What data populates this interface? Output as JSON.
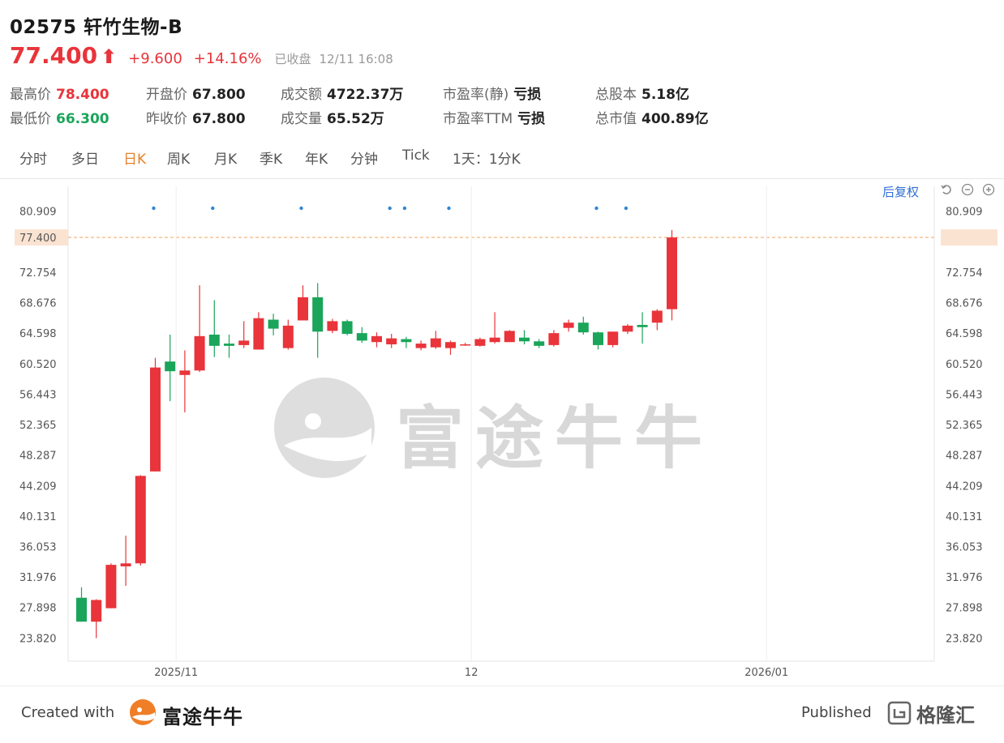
{
  "header": {
    "title": "02575 轩竹生物-B",
    "price": "77.400",
    "arrow": "⬆",
    "change": "+9.600",
    "change_pct": "+14.16%",
    "status": "已收盘",
    "status_time": "12/11 16:08"
  },
  "stats": {
    "high_label": "最高价",
    "high": "78.400",
    "low_label": "最低价",
    "low": "66.300",
    "open_label": "开盘价",
    "open": "67.800",
    "prev_label": "昨收价",
    "prev": "67.800",
    "turnover_label": "成交额",
    "turnover": "4722.37万",
    "volume_label": "成交量",
    "volume": "65.52万",
    "pe_static_label": "市盈率(静)",
    "pe_static": "亏损",
    "pe_ttm_label": "市盈率TTM",
    "pe_ttm": "亏损",
    "shares_label": "总股本",
    "shares": "5.18亿",
    "mktcap_label": "总市值",
    "mktcap": "400.89亿"
  },
  "tabs": [
    "分时",
    "多日",
    "日K",
    "周K",
    "月K",
    "季K",
    "年K",
    "分钟",
    "Tick",
    "1天：1分K"
  ],
  "active_tab": "日K",
  "controls": {
    "adjust": "后复权"
  },
  "colors": {
    "up": "#e8343a",
    "down": "#1aa55a",
    "accent": "#e8812a",
    "link": "#2f6fd4",
    "last_line": "#f2a35e"
  },
  "chart_data": {
    "type": "candlestick",
    "y_ticks": [
      "80.909",
      "77.400",
      "72.754",
      "68.676",
      "64.598",
      "60.520",
      "56.443",
      "52.365",
      "48.287",
      "44.209",
      "40.131",
      "36.053",
      "31.976",
      "27.898",
      "23.820"
    ],
    "ylim": [
      21.8,
      82.5
    ],
    "last_price": 77.4,
    "x_ticks": [
      {
        "label": "2025/11",
        "index": 6
      },
      {
        "label": "12",
        "index": 26
      },
      {
        "label": "2026/01",
        "index": 46
      }
    ],
    "event_dot_indices": [
      5,
      9,
      15,
      21,
      22,
      25,
      35,
      37
    ],
    "candles": [
      {
        "o": 29.2,
        "h": 30.6,
        "l": 26.0,
        "c": 26.0
      },
      {
        "o": 26.0,
        "h": 29.0,
        "l": 23.8,
        "c": 28.9
      },
      {
        "o": 27.8,
        "h": 33.8,
        "l": 27.8,
        "c": 33.6
      },
      {
        "o": 33.4,
        "h": 37.5,
        "l": 30.8,
        "c": 33.8
      },
      {
        "o": 33.8,
        "h": 45.6,
        "l": 33.5,
        "c": 45.5
      },
      {
        "o": 46.1,
        "h": 61.3,
        "l": 46.1,
        "c": 60.0
      },
      {
        "o": 60.8,
        "h": 64.4,
        "l": 55.5,
        "c": 59.5
      },
      {
        "o": 59.0,
        "h": 62.3,
        "l": 54.0,
        "c": 59.6
      },
      {
        "o": 59.6,
        "h": 71.0,
        "l": 59.4,
        "c": 64.2
      },
      {
        "o": 64.4,
        "h": 69.0,
        "l": 61.4,
        "c": 62.9
      },
      {
        "o": 63.2,
        "h": 64.4,
        "l": 61.3,
        "c": 62.9
      },
      {
        "o": 63.0,
        "h": 66.2,
        "l": 62.6,
        "c": 63.6
      },
      {
        "o": 62.4,
        "h": 67.4,
        "l": 62.4,
        "c": 66.6
      },
      {
        "o": 66.4,
        "h": 67.2,
        "l": 64.3,
        "c": 65.2
      },
      {
        "o": 62.6,
        "h": 66.4,
        "l": 62.4,
        "c": 65.6
      },
      {
        "o": 66.3,
        "h": 71.0,
        "l": 66.3,
        "c": 69.4
      },
      {
        "o": 69.4,
        "h": 71.3,
        "l": 61.3,
        "c": 64.8
      },
      {
        "o": 64.9,
        "h": 66.5,
        "l": 64.6,
        "c": 66.2
      },
      {
        "o": 66.2,
        "h": 66.4,
        "l": 64.3,
        "c": 64.5
      },
      {
        "o": 64.6,
        "h": 65.4,
        "l": 63.3,
        "c": 63.6
      },
      {
        "o": 63.4,
        "h": 64.7,
        "l": 62.7,
        "c": 64.2
      },
      {
        "o": 63.1,
        "h": 64.5,
        "l": 62.6,
        "c": 63.9
      },
      {
        "o": 63.8,
        "h": 64.1,
        "l": 62.6,
        "c": 63.4
      },
      {
        "o": 62.6,
        "h": 63.6,
        "l": 62.3,
        "c": 63.2
      },
      {
        "o": 62.7,
        "h": 64.9,
        "l": 62.5,
        "c": 63.9
      },
      {
        "o": 62.6,
        "h": 63.6,
        "l": 61.7,
        "c": 63.4
      },
      {
        "o": 63.1,
        "h": 63.3,
        "l": 62.9,
        "c": 63.1
      },
      {
        "o": 62.9,
        "h": 64.0,
        "l": 62.8,
        "c": 63.8
      },
      {
        "o": 63.4,
        "h": 67.4,
        "l": 63.2,
        "c": 64.0
      },
      {
        "o": 63.4,
        "h": 65.0,
        "l": 63.4,
        "c": 64.9
      },
      {
        "o": 64.0,
        "h": 65.0,
        "l": 63.1,
        "c": 63.5
      },
      {
        "o": 63.5,
        "h": 63.8,
        "l": 62.6,
        "c": 62.9
      },
      {
        "o": 63.0,
        "h": 65.0,
        "l": 62.8,
        "c": 64.6
      },
      {
        "o": 65.3,
        "h": 66.4,
        "l": 64.8,
        "c": 66.0
      },
      {
        "o": 66.0,
        "h": 66.8,
        "l": 64.4,
        "c": 64.7
      },
      {
        "o": 64.7,
        "h": 64.8,
        "l": 62.4,
        "c": 63.0
      },
      {
        "o": 63.0,
        "h": 64.8,
        "l": 62.7,
        "c": 64.8
      },
      {
        "o": 64.8,
        "h": 65.8,
        "l": 64.5,
        "c": 65.6
      },
      {
        "o": 65.7,
        "h": 67.4,
        "l": 63.2,
        "c": 65.4
      },
      {
        "o": 66.0,
        "h": 67.8,
        "l": 65.0,
        "c": 67.6
      },
      {
        "o": 67.8,
        "h": 78.4,
        "l": 66.3,
        "c": 77.4
      }
    ]
  },
  "watermark": {
    "text": "富途牛牛"
  },
  "footer": {
    "created": "Created with",
    "brand": "富途牛牛",
    "published": "Published",
    "publisher": "格隆汇"
  }
}
